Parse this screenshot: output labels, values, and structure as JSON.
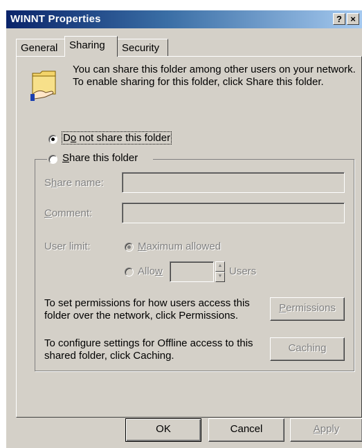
{
  "window": {
    "title": "WINNT Properties",
    "help_label": "?",
    "close_label": "×"
  },
  "tabs": [
    {
      "label": "General",
      "active": false
    },
    {
      "label": "Sharing",
      "active": true
    },
    {
      "label": "Security",
      "active": false
    }
  ],
  "sharing": {
    "description": "You can share this folder among other users on your network.  To enable sharing for this folder, click Share this folder.",
    "do_not_share": {
      "pre": "D",
      "accel": "o",
      "post": " not share this folder",
      "selected": true
    },
    "share_this": {
      "pre": "",
      "accel": "S",
      "post": "hare this folder",
      "selected": false
    },
    "share_name": {
      "pre": "S",
      "accel": "h",
      "post": "are name:",
      "value": ""
    },
    "comment": {
      "pre": "",
      "accel": "C",
      "post": "omment:",
      "value": ""
    },
    "user_limit_label": "User limit:",
    "maximum_allowed": {
      "pre": "",
      "accel": "M",
      "post": "aximum allowed",
      "selected": true
    },
    "allow": {
      "pre": "Allo",
      "accel": "w",
      "post": "",
      "selected": false,
      "value": ""
    },
    "users_label": "Users",
    "permissions_text": "To set permissions for how users access this folder over the network, click Permissions.",
    "permissions_button": {
      "pre": "",
      "accel": "P",
      "post": "ermissions"
    },
    "caching_text": "To configure settings for Offline access to this shared folder, click Caching.",
    "caching_button": {
      "pre": "Cachin",
      "accel": "g",
      "post": ""
    }
  },
  "footer": {
    "ok_label": "OK",
    "cancel_label": "Cancel",
    "apply": {
      "pre": "",
      "accel": "A",
      "post": "pply"
    }
  },
  "icons": {
    "shared_folder": "shared-folder-icon"
  },
  "colors": {
    "face": "#d4d0c8",
    "title_start": "#0a246a",
    "title_end": "#a6caf0",
    "disabled_text": "#808080"
  }
}
